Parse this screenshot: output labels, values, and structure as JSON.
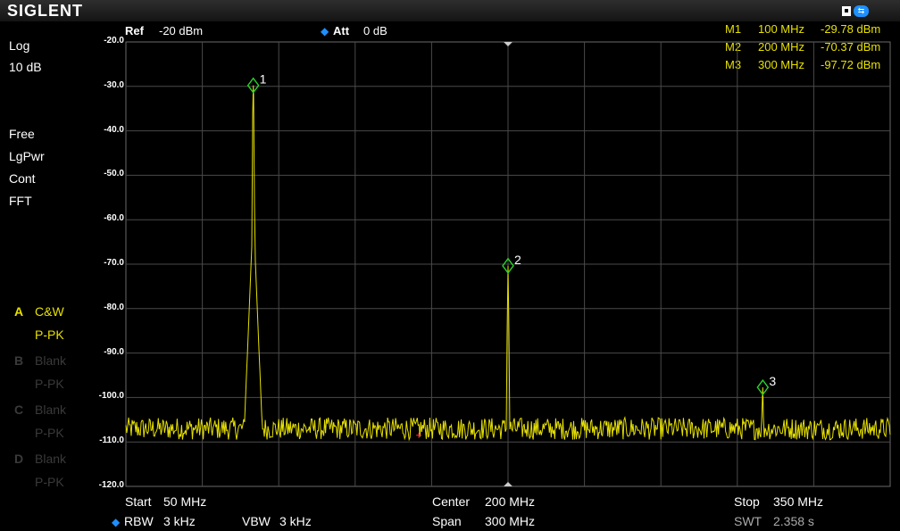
{
  "header": {
    "brand": "SIGLENT",
    "usb_icon": "usb-icon"
  },
  "left_panel": {
    "scale": "Log",
    "div": "10 dB",
    "trig": "Free",
    "det": "LgPwr",
    "mode": "Cont",
    "fft": "FFT",
    "traces": [
      {
        "id": "A",
        "mode": "C&W",
        "det": "P-PK",
        "active": true
      },
      {
        "id": "B",
        "mode": "Blank",
        "det": "P-PK",
        "active": false
      },
      {
        "id": "C",
        "mode": "Blank",
        "det": "P-PK",
        "active": false
      },
      {
        "id": "D",
        "mode": "Blank",
        "det": "P-PK",
        "active": false
      }
    ]
  },
  "top_info": {
    "ref_label": "Ref",
    "ref_value": "-20 dBm",
    "att_label": "Att",
    "att_value": "0 dB"
  },
  "markers": [
    {
      "name": "M1",
      "freq": "100 MHz",
      "level": "-29.78 dBm"
    },
    {
      "name": "M2",
      "freq": "200 MHz",
      "level": "-70.37 dBm"
    },
    {
      "name": "M3",
      "freq": "300 MHz",
      "level": "-97.72 dBm"
    }
  ],
  "bottom_info": {
    "start_label": "Start",
    "start_value": "50 MHz",
    "center_label": "Center",
    "center_value": "200 MHz",
    "stop_label": "Stop",
    "stop_value": "350 MHz",
    "rbw_label": "RBW",
    "rbw_value": "3 kHz",
    "vbw_label": "VBW",
    "vbw_value": "3 kHz",
    "span_label": "Span",
    "span_value": "300 MHz",
    "swt_label": "SWT",
    "swt_value": "2.358 s"
  },
  "colors": {
    "trace": "#e6e000",
    "grid": "#4a4a4a",
    "accent": "#1e8fff",
    "marker_active": "#e6e000"
  },
  "chart_data": {
    "type": "line",
    "x_unit": "MHz",
    "y_unit": "dBm",
    "xlim": [
      50,
      350
    ],
    "ylim": [
      -120,
      -20
    ],
    "y_ticks": [
      "-20.0",
      "-30.0",
      "-40.0",
      "-50.0",
      "-60.0",
      "-70.0",
      "-80.0",
      "-90.0",
      "-100.0",
      "-110.0",
      "-120.0"
    ],
    "noise_floor": -107,
    "noise_amplitude": 2.5,
    "peaks": [
      {
        "x": 100,
        "y": -29.78,
        "label": "1"
      },
      {
        "x": 200,
        "y": -70.37,
        "label": "2"
      },
      {
        "x": 300,
        "y": -97.72,
        "label": "3"
      }
    ],
    "grid": true
  }
}
